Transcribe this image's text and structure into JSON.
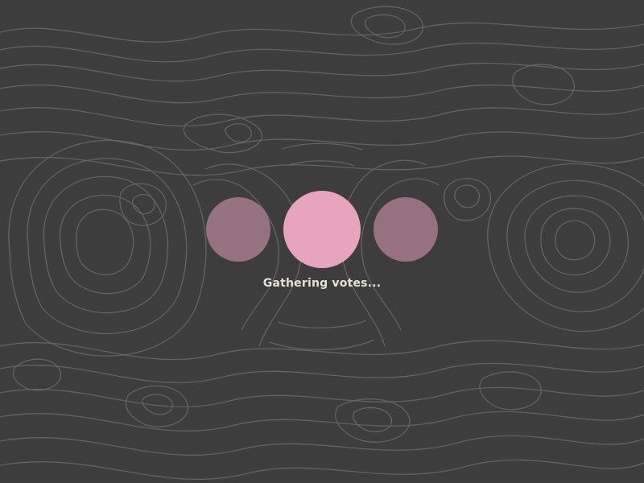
{
  "background": {
    "color": "#3d3d3d",
    "pattern": "topographic-contour-lines",
    "line_color": "#6a6a6a"
  },
  "loader": {
    "dots": [
      {
        "name": "left",
        "color": "#e8a3bd",
        "state": "dim"
      },
      {
        "name": "center",
        "color": "#e8a3bd",
        "state": "active"
      },
      {
        "name": "right",
        "color": "#e8a3bd",
        "state": "dim"
      }
    ],
    "status_text": "Gathering votes..."
  }
}
